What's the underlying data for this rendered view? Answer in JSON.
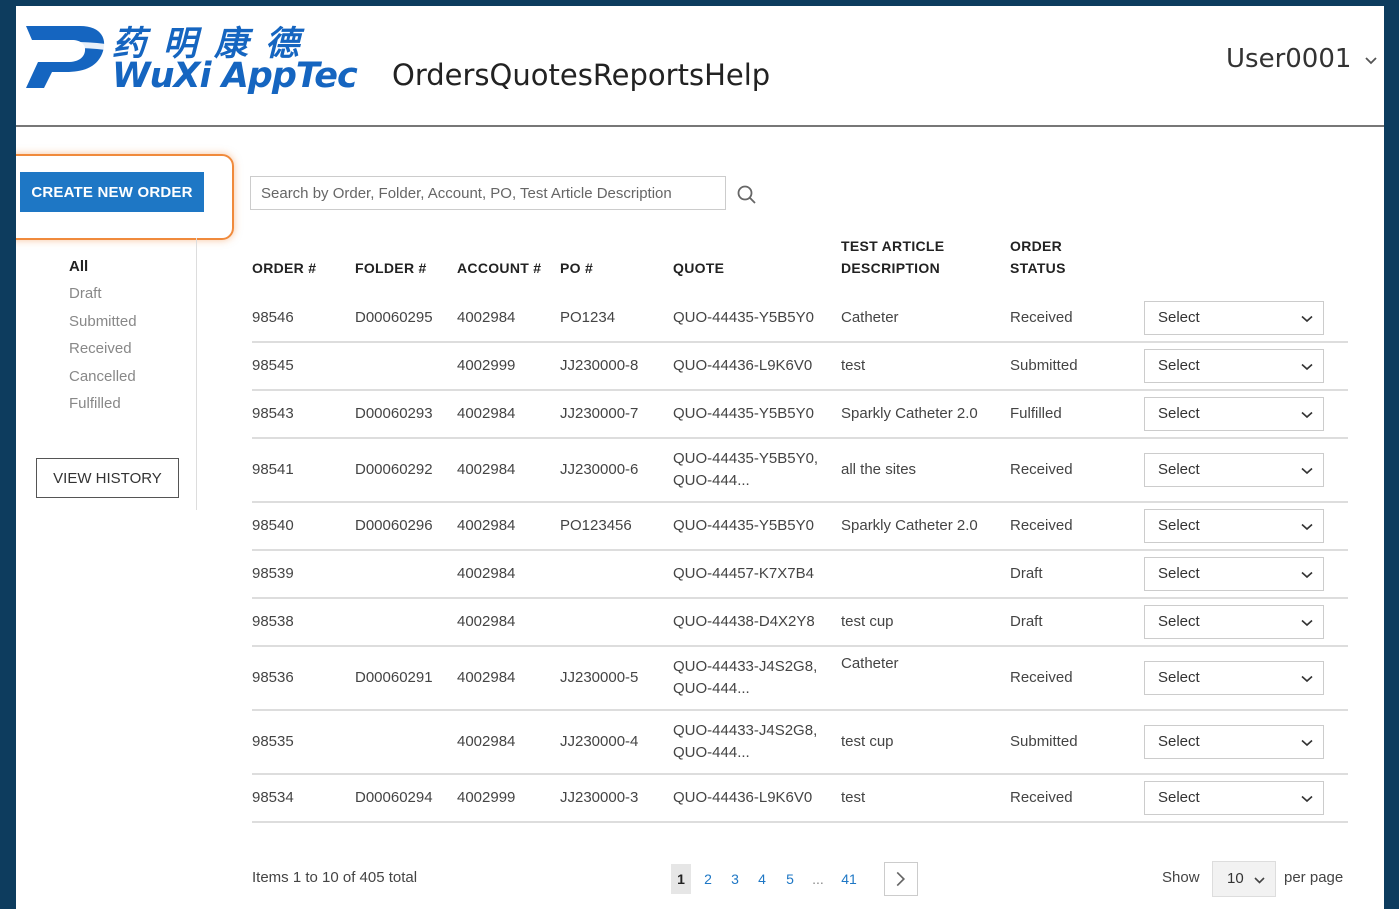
{
  "brand": {
    "name_cn": "药明康德",
    "name_en": "WuXi AppTec",
    "color": "#1565c0"
  },
  "nav": {
    "items": [
      "Orders",
      "Quotes",
      "Reports",
      "Help"
    ]
  },
  "user": {
    "name": "User0001"
  },
  "sidebar": {
    "create_order_label": "CREATE NEW ORDER",
    "filters": [
      "All",
      "Draft",
      "Submitted",
      "Received",
      "Cancelled",
      "Fulfilled"
    ],
    "active_filter": "All",
    "view_history_label": "VIEW HISTORY"
  },
  "search": {
    "placeholder": "Search by Order, Folder, Account, PO, Test Article Description"
  },
  "table": {
    "headers": {
      "order": "ORDER #",
      "folder": "FOLDER #",
      "account": "ACCOUNT #",
      "po": "PO #",
      "quote": "QUOTE",
      "test_article_1": "TEST ARTICLE",
      "test_article_2": "DESCRIPTION",
      "status_1": "ORDER",
      "status_2": "STATUS"
    },
    "rows": [
      {
        "order": "98546",
        "folder": "D00060295",
        "account": "4002984",
        "po": "PO1234",
        "quote": [
          "QUO-44435-Y5B5Y0"
        ],
        "desc": "Catheter",
        "status": "Received",
        "action": "Select"
      },
      {
        "order": "98545",
        "folder": "",
        "account": "4002999",
        "po": "JJ230000-8",
        "quote": [
          "QUO-44436-L9K6V0"
        ],
        "desc": "test",
        "status": "Submitted",
        "action": "Select"
      },
      {
        "order": "98543",
        "folder": "D00060293",
        "account": "4002984",
        "po": "JJ230000-7",
        "quote": [
          "QUO-44435-Y5B5Y0"
        ],
        "desc": "Sparkly Catheter 2.0",
        "status": "Fulfilled",
        "action": "Select"
      },
      {
        "order": "98541",
        "folder": "D00060292",
        "account": "4002984",
        "po": "JJ230000-6",
        "quote": [
          "QUO-44435-Y5B5Y0,",
          "QUO-444..."
        ],
        "desc": "all the sites",
        "status": "Received",
        "action": "Select"
      },
      {
        "order": "98540",
        "folder": "D00060296",
        "account": "4002984",
        "po": "PO123456",
        "quote": [
          "QUO-44435-Y5B5Y0"
        ],
        "desc": "Sparkly Catheter 2.0",
        "status": "Received",
        "action": "Select"
      },
      {
        "order": "98539",
        "folder": "",
        "account": "4002984",
        "po": "",
        "quote": [
          "QUO-44457-K7X7B4"
        ],
        "desc": "",
        "status": "Draft",
        "action": "Select"
      },
      {
        "order": "98538",
        "folder": "",
        "account": "4002984",
        "po": "",
        "quote": [
          "QUO-44438-D4X2Y8"
        ],
        "desc": "test cup",
        "status": "Draft",
        "action": "Select"
      },
      {
        "order": "98536",
        "folder": "D00060291",
        "account": "4002984",
        "po": "JJ230000-5",
        "quote": [
          "QUO-44433-J4S2G8,",
          "QUO-444..."
        ],
        "desc": "Catheter",
        "status": "Received",
        "action": "Select"
      },
      {
        "order": "98535",
        "folder": "",
        "account": "4002984",
        "po": "JJ230000-4",
        "quote": [
          "QUO-44433-J4S2G8,",
          "QUO-444..."
        ],
        "desc": "test cup",
        "status": "Submitted",
        "action": "Select"
      },
      {
        "order": "98534",
        "folder": "D00060294",
        "account": "4002999",
        "po": "JJ230000-3",
        "quote": [
          "QUO-44436-L9K6V0"
        ],
        "desc": "test",
        "status": "Received",
        "action": "Select"
      }
    ]
  },
  "pagination": {
    "summary": "Items 1 to 10 of 405 total",
    "pages": [
      "1",
      "2",
      "3",
      "4",
      "5",
      "...",
      "41"
    ],
    "current_page": "1",
    "show_label": "Show",
    "per_page_value": "10",
    "per_page_label": "per page"
  },
  "colors": {
    "accent": "#1e77c5",
    "highlight": "#f08a3c",
    "frame": "#0d3c5e"
  }
}
